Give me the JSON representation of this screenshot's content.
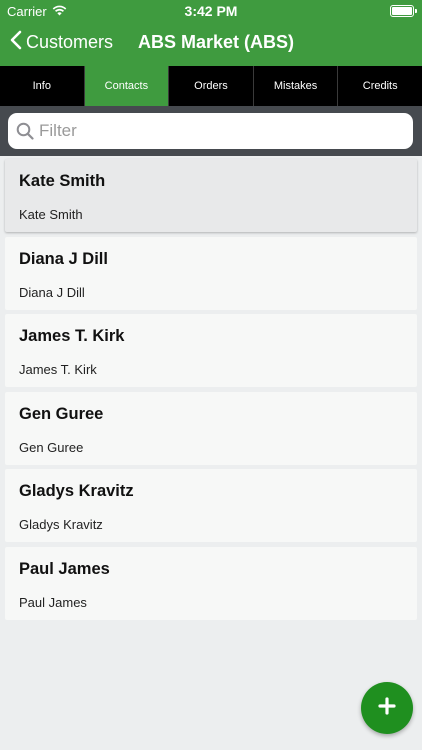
{
  "status_bar": {
    "carrier": "Carrier",
    "time": "3:42 PM"
  },
  "nav": {
    "back_label": "Customers",
    "title": "ABS Market (ABS)"
  },
  "tabs": [
    {
      "label": "Info",
      "active": false
    },
    {
      "label": "Contacts",
      "active": true
    },
    {
      "label": "Orders",
      "active": false
    },
    {
      "label": "Mistakes",
      "active": false
    },
    {
      "label": "Credits",
      "active": false
    }
  ],
  "search": {
    "placeholder": "Filter",
    "value": ""
  },
  "contacts": [
    {
      "name": "Kate Smith",
      "subtitle": "Kate Smith",
      "selected": true
    },
    {
      "name": "Diana J Dill",
      "subtitle": "Diana J Dill",
      "selected": false
    },
    {
      "name": "James T. Kirk",
      "subtitle": "James T. Kirk",
      "selected": false
    },
    {
      "name": "Gen Guree",
      "subtitle": "Gen Guree",
      "selected": false
    },
    {
      "name": "Gladys Kravitz",
      "subtitle": "Gladys Kravitz",
      "selected": false
    },
    {
      "name": "Paul James",
      "subtitle": "Paul James",
      "selected": false
    }
  ],
  "icons": {
    "wifi": "wifi-icon",
    "battery": "battery-icon",
    "back": "chevron-left-icon",
    "search": "search-icon",
    "add": "plus-icon"
  },
  "colors": {
    "brand_green": "#3f9b3f",
    "fab_green": "#1f8f1f",
    "tab_bar": "#000000",
    "search_bar": "#464a4f"
  }
}
